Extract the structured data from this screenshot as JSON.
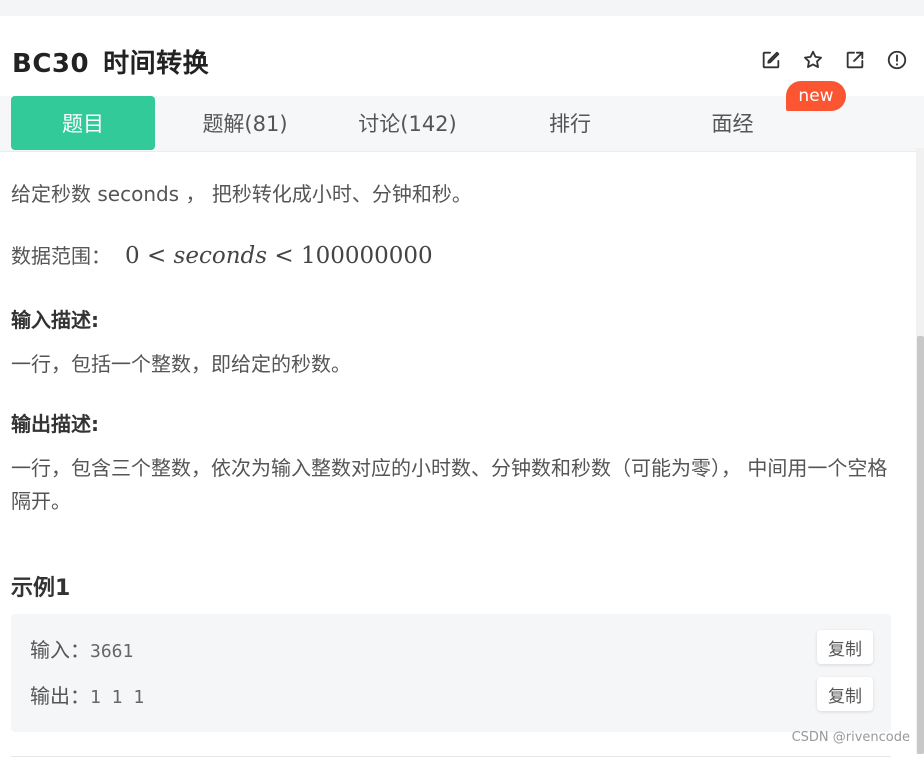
{
  "problem": {
    "code": "BC30",
    "title": "时间转换"
  },
  "actions": [
    {
      "icon": "edit-icon"
    },
    {
      "icon": "star-icon"
    },
    {
      "icon": "share-icon"
    },
    {
      "icon": "report-icon"
    }
  ],
  "tabs": [
    {
      "label": "题目",
      "active": true
    },
    {
      "label": "题解(81)"
    },
    {
      "label": "讨论(142)"
    },
    {
      "label": "排行"
    },
    {
      "label": "面经"
    }
  ],
  "new_badge": "new",
  "body": {
    "description": "给定秒数 seconds ， 把秒转化成小时、分钟和秒。",
    "range_label": "数据范围：",
    "range_low": "0",
    "range_op": "<",
    "range_var": "seconds",
    "range_high": "100000000",
    "input_heading": "输入描述:",
    "input_text": "一行，包括一个整数，即给定的秒数。",
    "output_heading": "输出描述:",
    "output_text": "一行，包含三个整数，依次为输入整数对应的小时数、分钟数和秒数（可能为零）， 中间用一个空格隔开。",
    "example_heading": "示例1"
  },
  "example": {
    "input_label": "输入：",
    "input_value": "3661",
    "output_label": "输出：",
    "output_value": "1 1 1",
    "copy_label": "复制"
  },
  "watermark": "CSDN @rivencode",
  "colors": {
    "accent": "#32ca99",
    "badge": "#fc5531"
  }
}
